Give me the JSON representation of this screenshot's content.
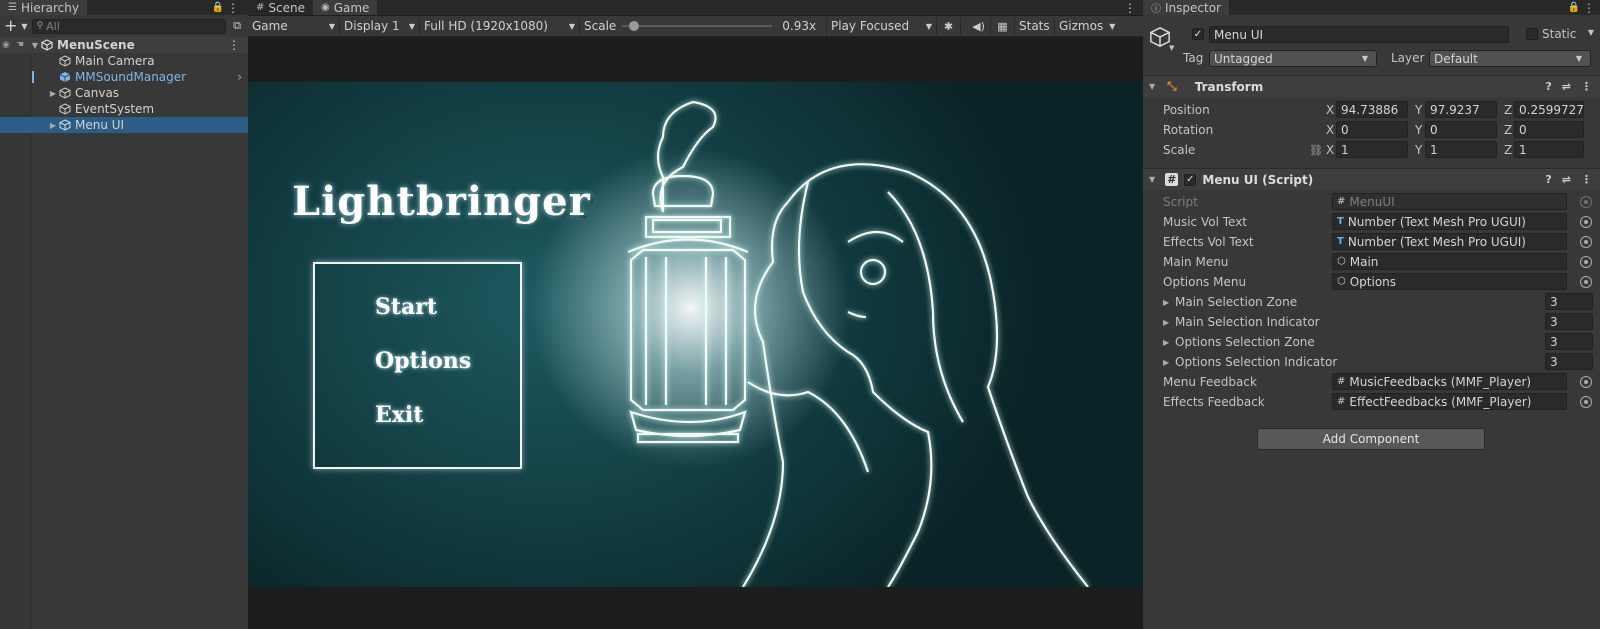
{
  "hierarchy": {
    "tab_label": "Hierarchy",
    "search_placeholder": "All",
    "scene_name": "MenuScene",
    "items": [
      {
        "label": "Main Camera"
      },
      {
        "label": "MMSoundManager"
      },
      {
        "label": "Canvas"
      },
      {
        "label": "EventSystem"
      },
      {
        "label": "Menu UI"
      }
    ]
  },
  "game_view": {
    "tabs": [
      {
        "label": "Scene"
      },
      {
        "label": "Game"
      }
    ],
    "toolbar": {
      "view_mode": "Game",
      "display": "Display 1",
      "resolution": "Full HD (1920x1080)",
      "scale_label": "Scale",
      "scale_value": "0.93x",
      "scale_fraction": 0.05,
      "play_mode": "Play Focused",
      "stats_label": "Stats",
      "gizmos_label": "Gizmos"
    },
    "game": {
      "title": "Lightbringer",
      "menu_items": [
        "Start",
        "Options",
        "Exit"
      ]
    }
  },
  "inspector": {
    "tab_label": "Inspector",
    "object_name": "Menu UI",
    "static_label": "Static",
    "tag_label": "Tag",
    "tag_value": "Untagged",
    "layer_label": "Layer",
    "layer_value": "Default",
    "transform": {
      "title": "Transform",
      "rows": [
        {
          "label": "Position",
          "x": "94.73886",
          "y": "97.9237",
          "z": "0.2599727"
        },
        {
          "label": "Rotation",
          "x": "0",
          "y": "0",
          "z": "0"
        },
        {
          "label": "Scale",
          "x": "1",
          "y": "1",
          "z": "1"
        }
      ],
      "axis_x": "X",
      "axis_y": "Y",
      "axis_z": "Z"
    },
    "script_component": {
      "title": "Menu UI (Script)",
      "script_label": "Script",
      "script_value": "MenuUI",
      "fields": [
        {
          "label": "Music Vol Text",
          "value": "Number (Text Mesh Pro UGUI)"
        },
        {
          "label": "Effects Vol Text",
          "value": "Number (Text Mesh Pro UGUI)"
        },
        {
          "label": "Main Menu",
          "value": "Main"
        },
        {
          "label": "Options Menu",
          "value": "Options"
        }
      ],
      "arrays": [
        {
          "label": "Main Selection Zone",
          "value": "3"
        },
        {
          "label": "Main Selection Indicator",
          "value": "3"
        },
        {
          "label": "Options Selection Zone",
          "value": "3"
        },
        {
          "label": "Options Selection Indicator",
          "value": "3"
        }
      ],
      "feedbacks": [
        {
          "label": "Menu Feedback",
          "value": "MusicFeedbacks (MMF_Player)"
        },
        {
          "label": "Effects Feedback",
          "value": "EffectFeedbacks (MMF_Player)"
        }
      ]
    },
    "add_component_label": "Add Component"
  },
  "colors": {
    "selection": "#2c5d87",
    "prefab_blue": "#7eb4ea",
    "game_bg": "#0d2f33"
  }
}
